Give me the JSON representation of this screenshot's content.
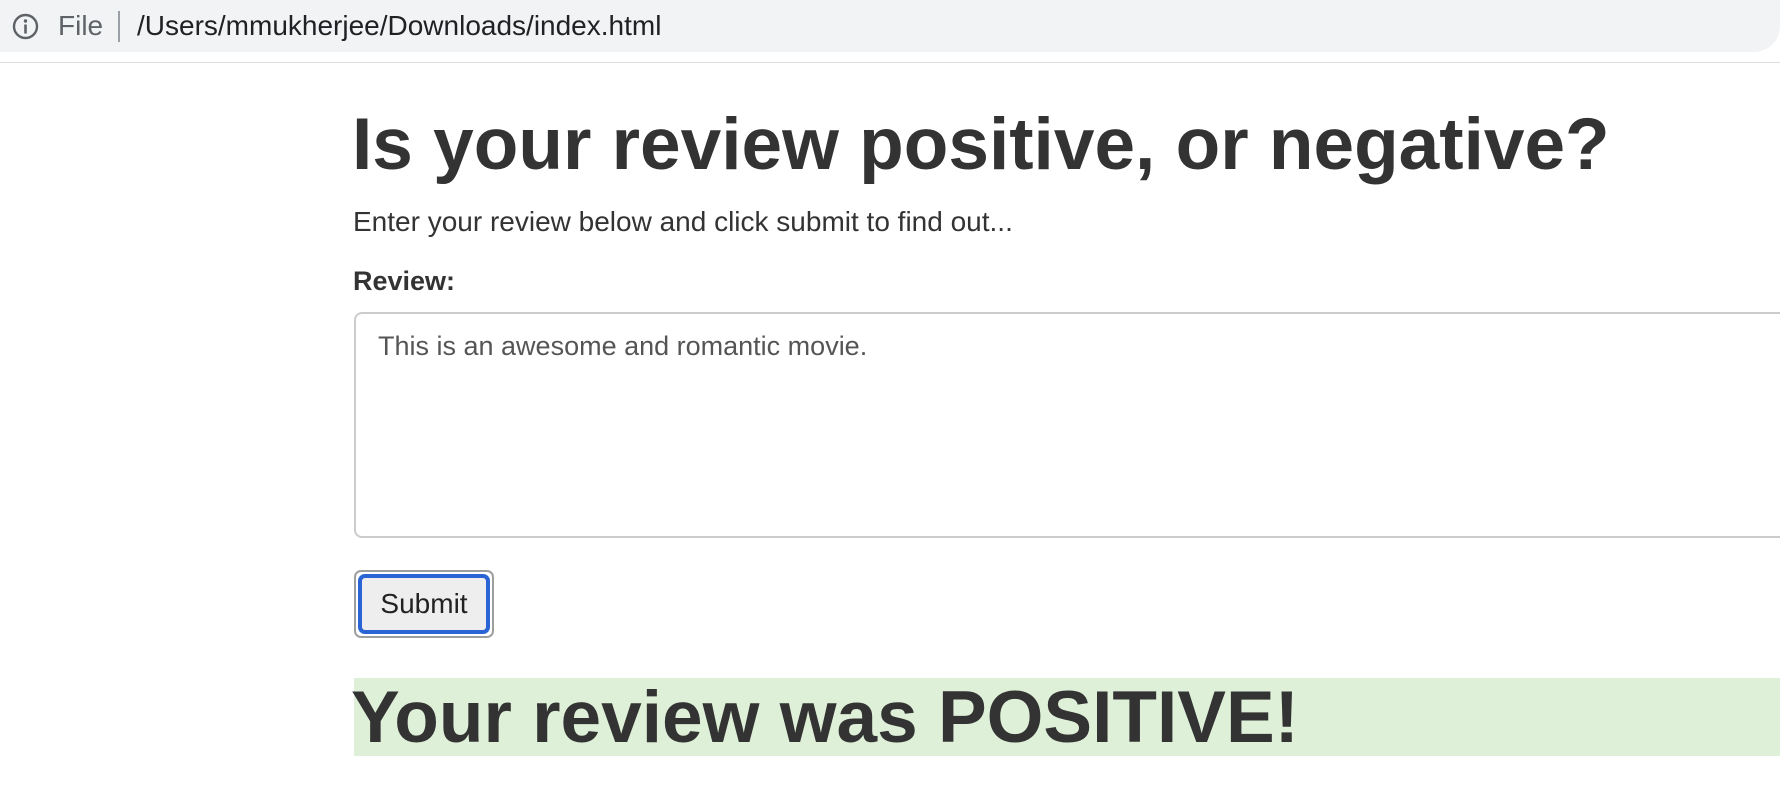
{
  "browser": {
    "info_icon": "info-circle-icon",
    "scheme_label": "File",
    "url": "/Users/mmukherjee/Downloads/index.html"
  },
  "page": {
    "heading": "Is your review positive, or negative?",
    "subtitle": "Enter your review below and click submit to find out...",
    "review_label": "Review:",
    "review_value": "This is an awesome and romantic movie.",
    "submit_label": "Submit",
    "result_text": "Your review was POSITIVE!",
    "result_background": "#dff0d8",
    "submit_focus_color": "#2a63d4"
  }
}
